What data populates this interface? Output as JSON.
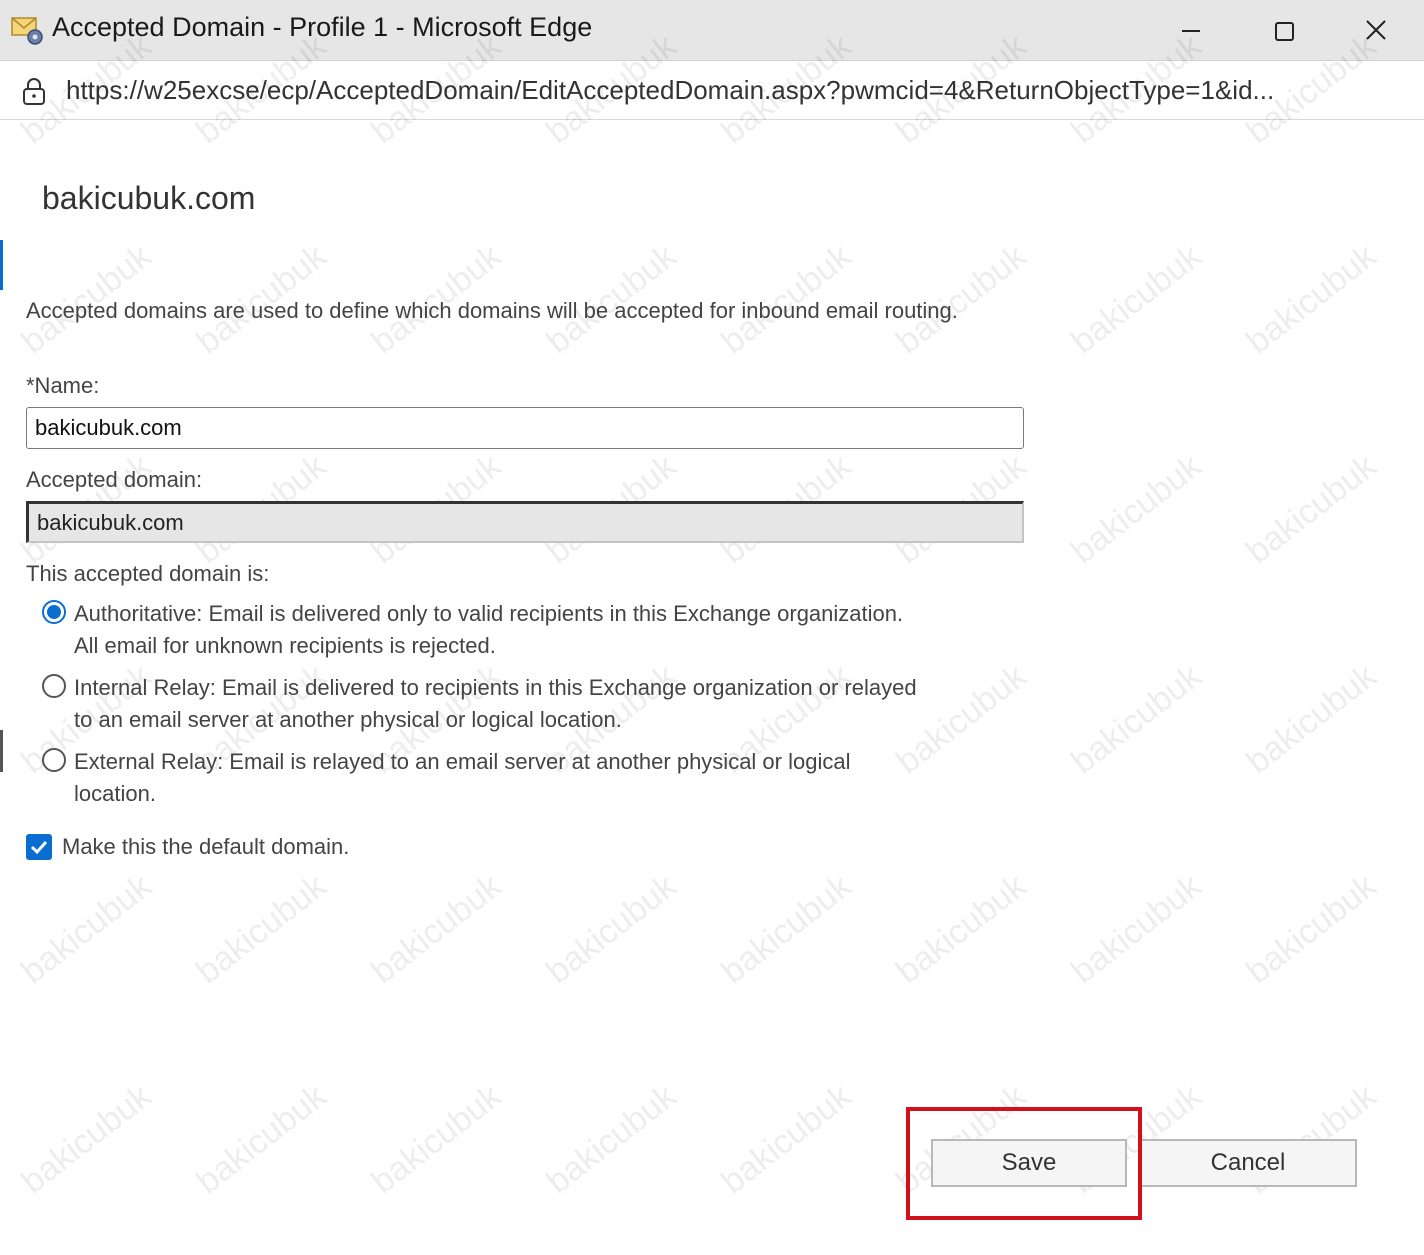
{
  "window": {
    "title": "Accepted Domain - Profile 1 - Microsoft Edge",
    "url": "https://w25excse/ecp/AcceptedDomain/EditAcceptedDomain.aspx?pwmcid=4&ReturnObjectType=1&id..."
  },
  "page": {
    "title": "bakicubuk.com",
    "description": "Accepted domains are used to define which domains will be accepted for inbound email routing."
  },
  "form": {
    "name_label": "*Name:",
    "name_value": "bakicubuk.com",
    "accepted_domain_label": "Accepted domain:",
    "accepted_domain_value": "bakicubuk.com",
    "type_label": "This accepted domain is:",
    "options": [
      {
        "label": "Authoritative: Email is delivered only to valid recipients in this Exchange organization. All email for unknown recipients is rejected.",
        "selected": true
      },
      {
        "label": "Internal Relay: Email is delivered to recipients in this Exchange organization or relayed to an email server at another physical or logical location.",
        "selected": false
      },
      {
        "label": "External Relay: Email is relayed to an email server at another physical or logical location.",
        "selected": false
      }
    ],
    "default_checkbox_label": "Make this the default domain.",
    "default_checked": true
  },
  "buttons": {
    "save": "Save",
    "cancel": "Cancel"
  },
  "watermark": "bakicubuk",
  "colors": {
    "accent": "#0a6ed1",
    "highlight": "#d0101d"
  },
  "icons": {
    "app": "exchange-mail-icon",
    "lock": "lock-icon",
    "minimize": "minimize-icon",
    "maximize": "maximize-icon",
    "close": "close-icon",
    "check": "checkmark-icon"
  }
}
